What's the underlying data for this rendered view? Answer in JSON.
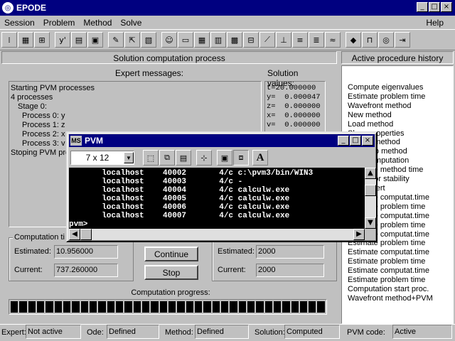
{
  "app": {
    "title": "EPODE",
    "icon": "epode-logo-icon"
  },
  "window_buttons": {
    "minimize": "_",
    "maximize": "□",
    "close": "×"
  },
  "menu": {
    "items": [
      "Session",
      "Problem",
      "Method",
      "Solve"
    ],
    "help": "Help"
  },
  "toolbar": {
    "icons": [
      "tool-1-icon",
      "tool-2-icon",
      "tool-3-icon",
      "tool-4-icon",
      "tool-5-icon",
      "tool-6-icon",
      "tool-7-icon",
      "tool-8-icon",
      "tool-9-icon",
      "tool-10-icon",
      "tool-11-icon",
      "tool-12-icon",
      "tool-13-icon",
      "tool-14-icon",
      "tool-15-icon",
      "tool-16-icon",
      "tool-17-icon",
      "tool-18-icon",
      "tool-19-icon",
      "tool-20-icon",
      "tool-21-icon",
      "tool-22-icon",
      "tool-23-icon",
      "tool-24-icon",
      "tool-25-icon"
    ]
  },
  "solution_panel": {
    "title": "Solution computation process",
    "expert_label": "Expert messages:",
    "values_label": "Solution values:",
    "messages": [
      "Starting PVM processes",
      "4 processes",
      "Stage 0:",
      "Process 0: y",
      "Process 1: z",
      "Process 2: x",
      "Process 3: v",
      "Stoping PVM pro"
    ],
    "values": [
      "t=20.000000",
      "y=  0.000047",
      "z=  0.000000",
      "x=  0.000000",
      "v=  0.000000"
    ]
  },
  "computation_time": {
    "label": "Computation ti",
    "estimated_label": "Estimated:",
    "estimated_value": "10.956000",
    "current_label": "Current:",
    "current_value": "737.260000"
  },
  "buttons": {
    "continue": "Continue",
    "stop": "Stop"
  },
  "steps": {
    "estimated_label": "Estimated:",
    "estimated_value": "2000",
    "current_label": "Current:",
    "current_value": "2000"
  },
  "progress": {
    "label": "Computation progress:",
    "segments": 36
  },
  "history": {
    "title": "Active procedure history",
    "items": [
      "Compute eigenvalues",
      "Estimate problem time",
      "Wavefront method",
      "New method",
      "Load method",
      "Show properties",
      "Implicit method",
      "Multistep method",
      "Start computation",
      "Estimate method time",
      "Check for stability",
      "Call expert",
      "Estimate computat.time",
      "Estimate problem time",
      "Estimate computat.time",
      "Estimate problem time",
      "Estimate computat.time",
      "Estimate problem time",
      "Estimate computat.time",
      "Estimate problem time",
      "Estimate computat.time",
      "Estimate problem time",
      "Computation start proc.",
      "Wavefront method+PVM"
    ]
  },
  "status": {
    "expert_label": "Expert:",
    "expert_value": "Not active",
    "ode_label": "Ode:",
    "ode_value": "Defined",
    "method_label": "Method:",
    "method_value": "Defined",
    "solution_label": "Solution:",
    "solution_value": "Computed",
    "pvm_label": "PVM code:",
    "pvm_value": "Active"
  },
  "pvm_window": {
    "title": "PVM",
    "font_size": "7 x 12",
    "font_button": "A",
    "rows": [
      "       localhost    40002       4/c c:\\pvm3/bin/WIN3",
      "       localhost    40003       4/c -",
      "       localhost    40004       4/c calculw.exe",
      "       localhost    40005       4/c calculw.exe",
      "       localhost    40006       4/c calculw.exe",
      "       localhost    40007       4/c calculw.exe"
    ],
    "prompt": "pvm>"
  }
}
